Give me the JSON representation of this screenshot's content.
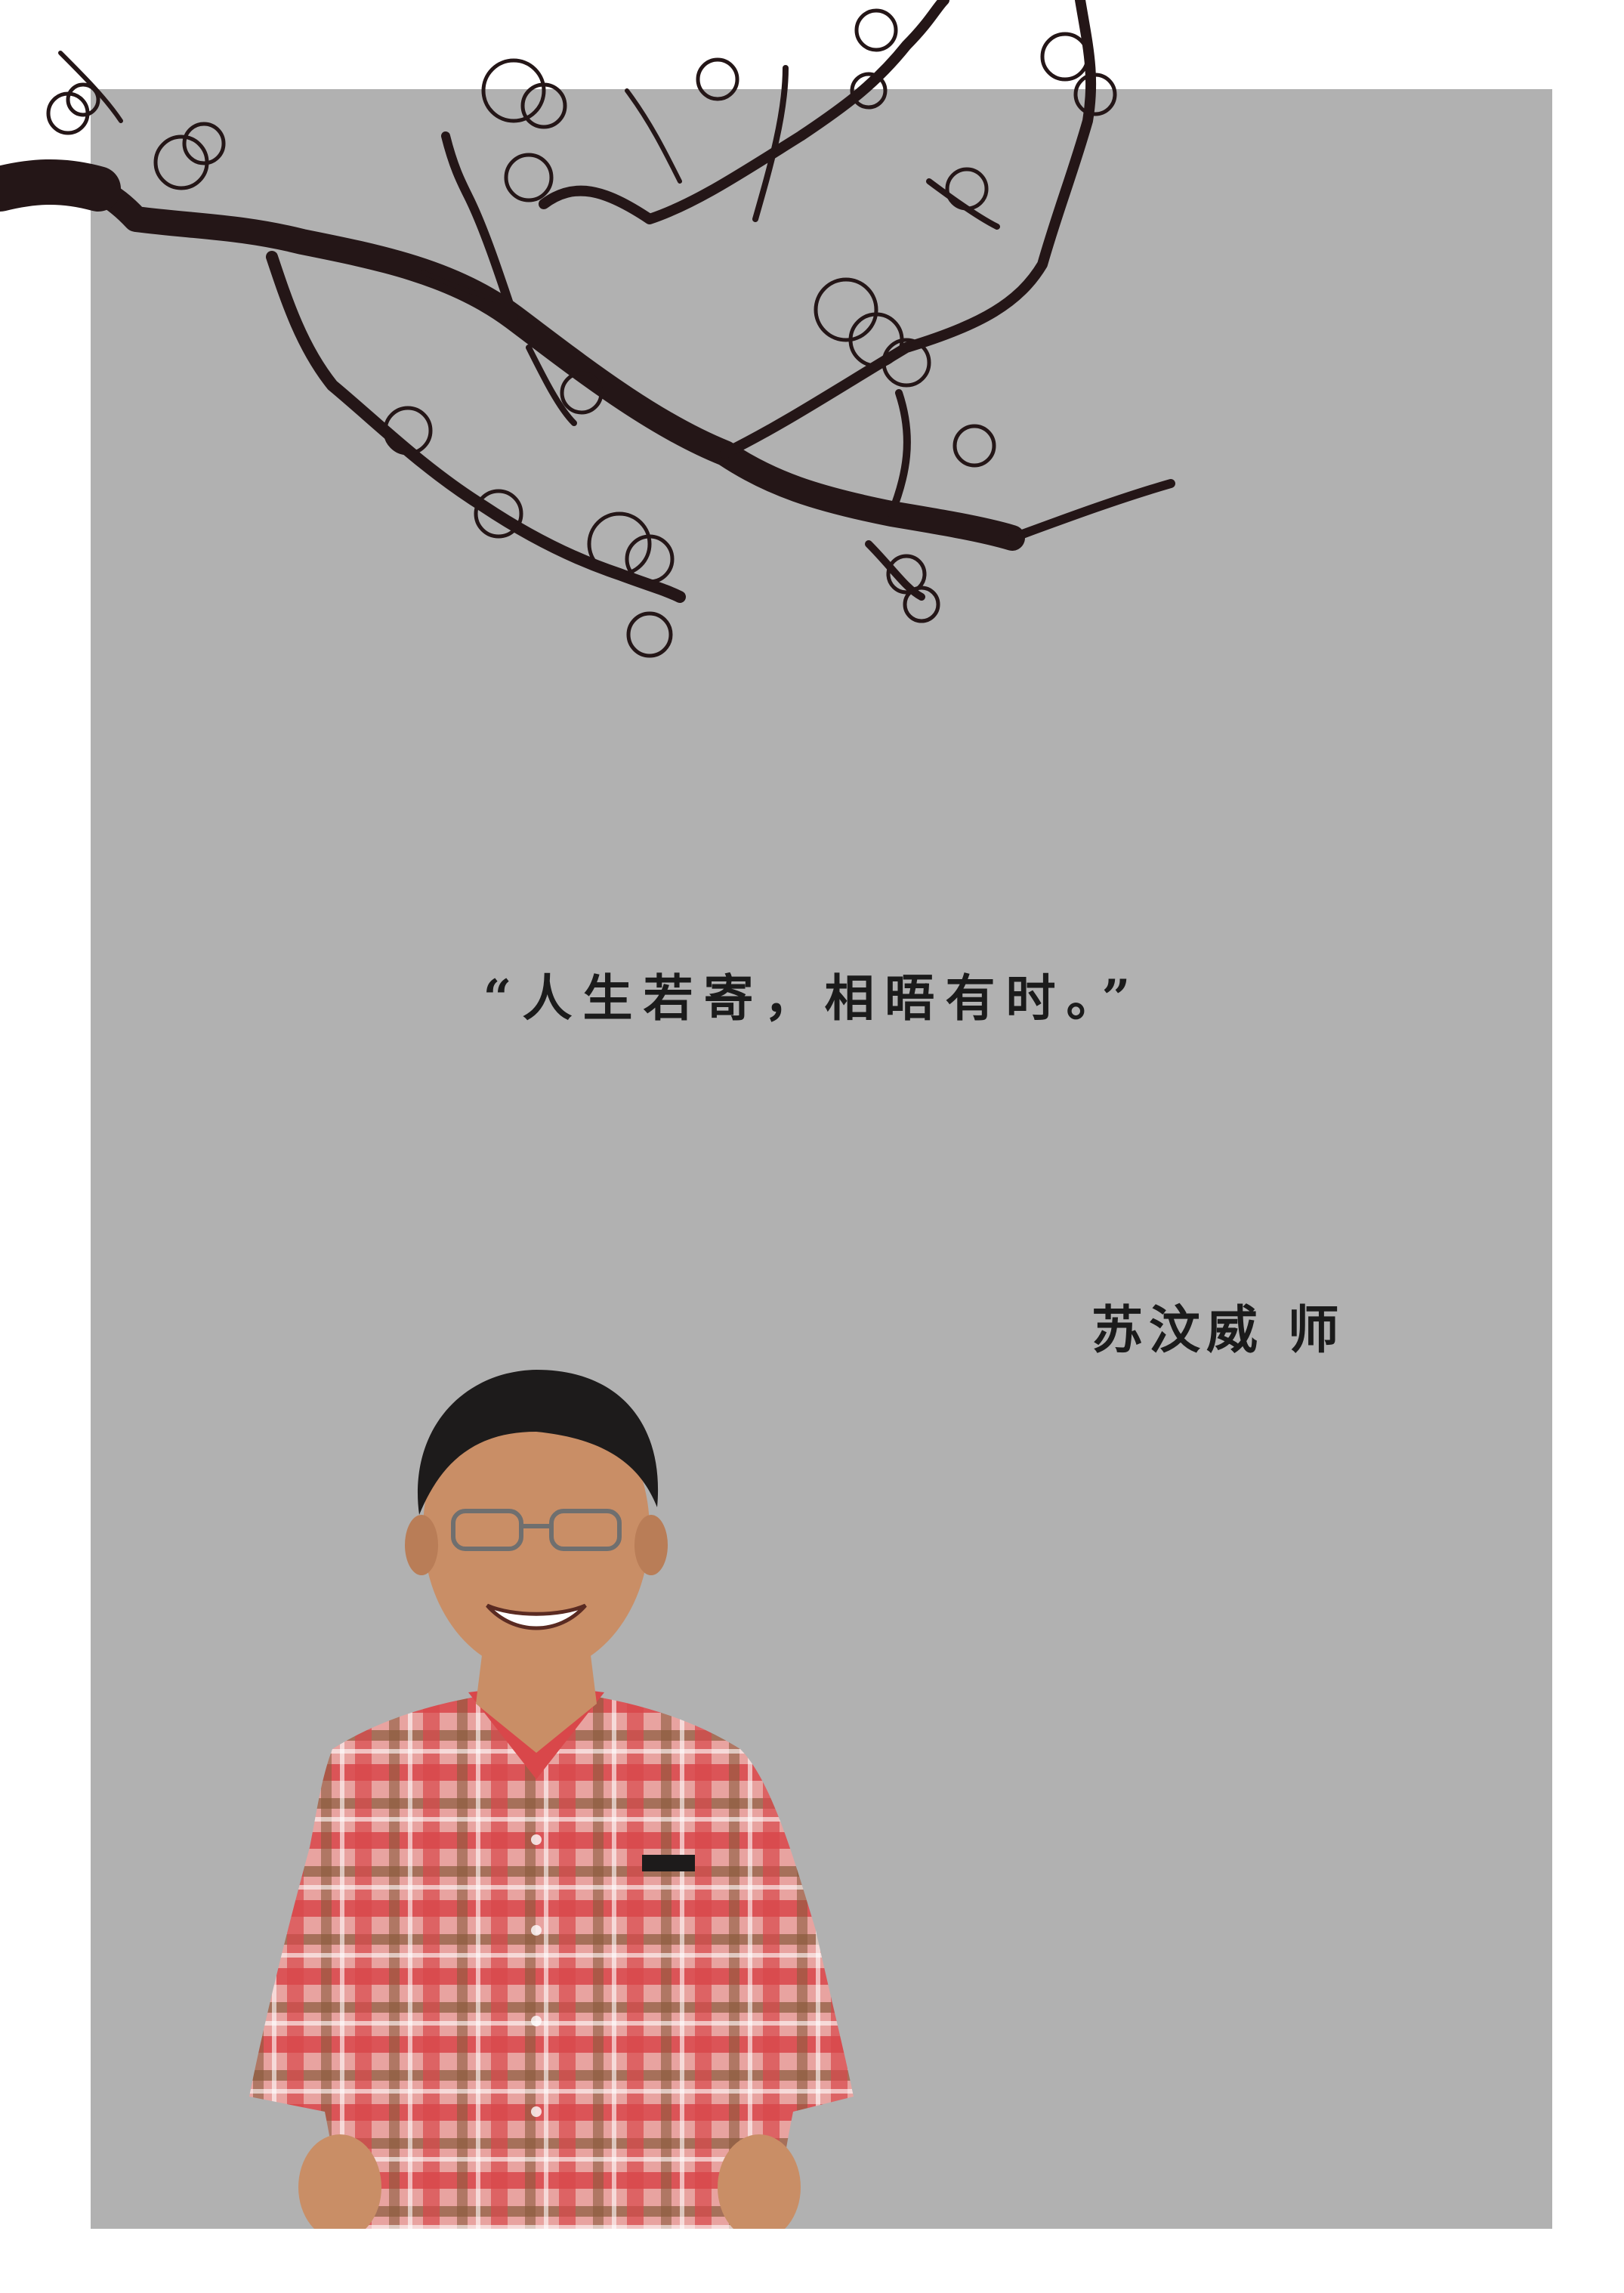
{
  "quote": "“人生若寄，相晤有时。”",
  "signature": "苏汶威 师",
  "colors": {
    "background": "#ffffff",
    "panel": "#b1b1b1",
    "ink": "#1b1b1b",
    "branch": "#241617",
    "shirt_red": "#d9474a",
    "skin": "#c98e66"
  },
  "images": {
    "branch": "plum-blossom-branch-illustration",
    "portrait": "smiling-man-plaid-shirt-photo"
  }
}
